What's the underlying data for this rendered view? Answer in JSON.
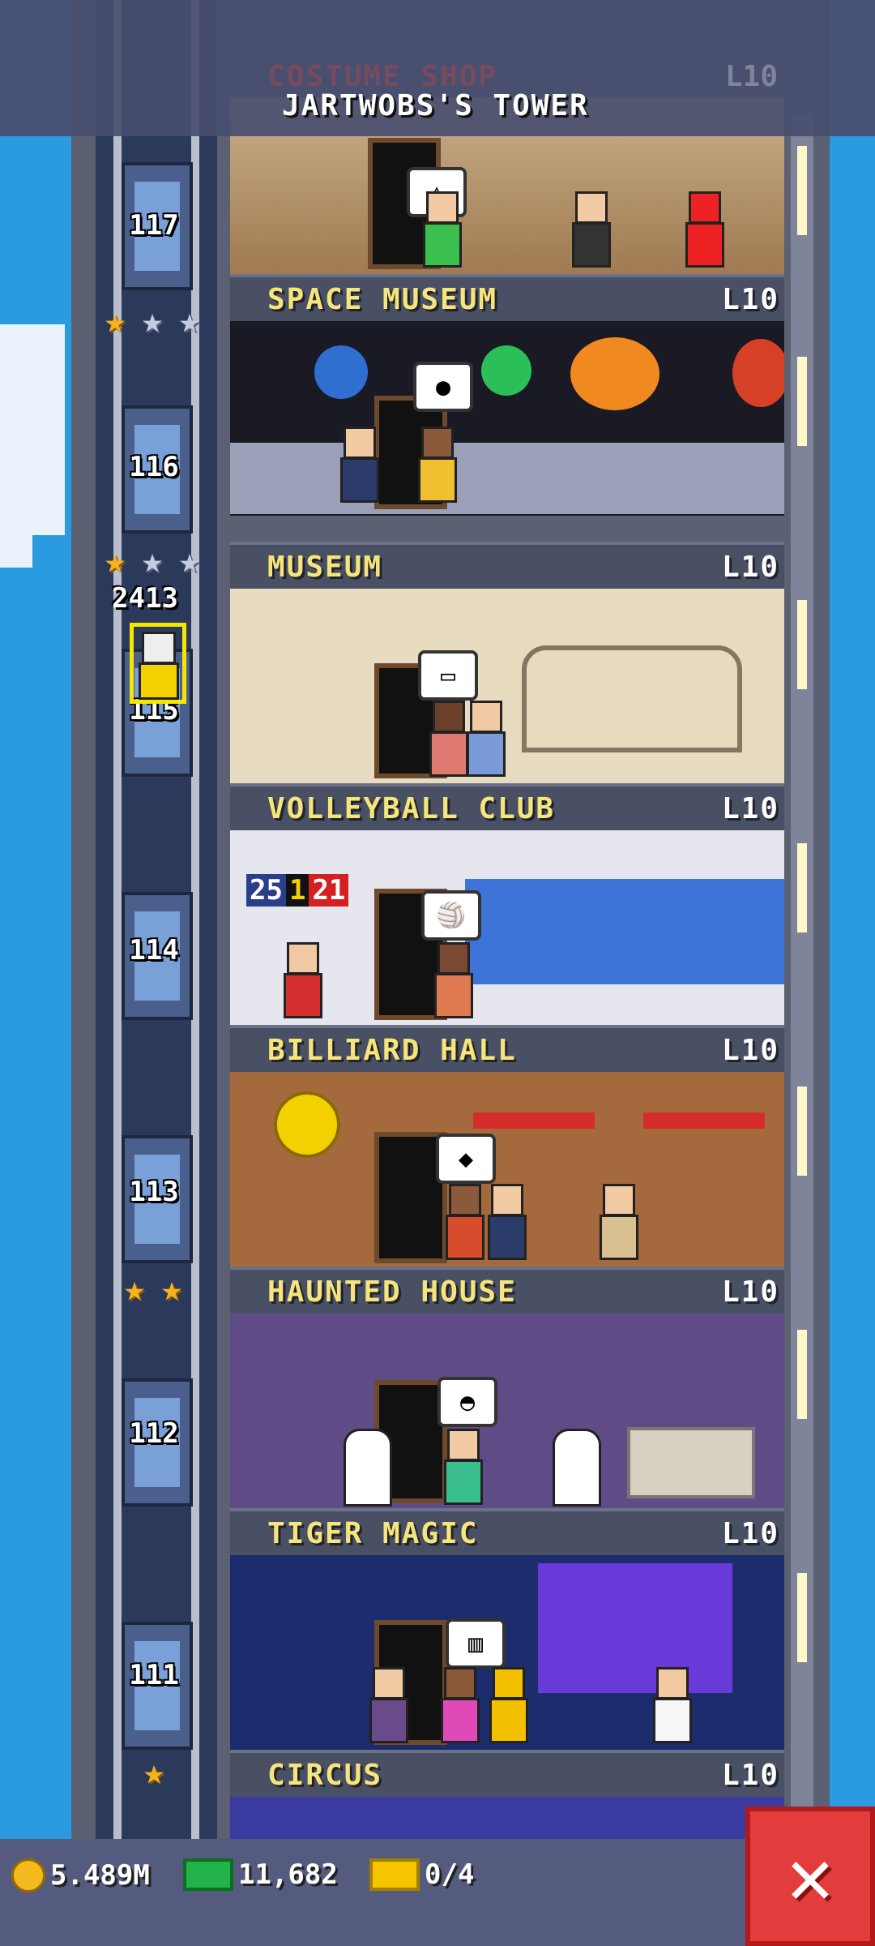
{
  "tower_title": "JARTWOBS'S TOWER",
  "header_partial_floor": {
    "name": "COSTUME SHOP",
    "level": "L10"
  },
  "elevator": {
    "passenger_count": "2413"
  },
  "floors": [
    {
      "number": "117",
      "name": "SPACE MUSEUM",
      "level": "L10",
      "stars_gold": 1,
      "stars_silver": 2
    },
    {
      "number": "116",
      "name": "MUSEUM",
      "level": "L10",
      "stars_gold": 1,
      "stars_silver": 2
    },
    {
      "number": "115",
      "name": "VOLLEYBALL CLUB",
      "level": "L10",
      "stars_gold": 0,
      "stars_silver": 0
    },
    {
      "number": "114",
      "name": "BILLIARD HALL",
      "level": "L10",
      "stars_gold": 0,
      "stars_silver": 0
    },
    {
      "number": "113",
      "name": "HAUNTED HOUSE",
      "level": "L10",
      "stars_gold": 2,
      "stars_silver": 0
    },
    {
      "number": "112",
      "name": "TIGER MAGIC",
      "level": "L10",
      "stars_gold": 0,
      "stars_silver": 0
    },
    {
      "number": "111",
      "name": "CIRCUS",
      "level": "L10",
      "stars_gold": 1,
      "stars_silver": 0
    }
  ],
  "scoreboard": {
    "left": "25",
    "middle": "1",
    "right": "21"
  },
  "bottom_bar": {
    "coins": "5.489M",
    "bux": "11,682",
    "tickets": "0/4"
  },
  "colors": {
    "sky": "#2a9be0",
    "label_text": "#f6e57a",
    "close": "#e33c3c"
  }
}
